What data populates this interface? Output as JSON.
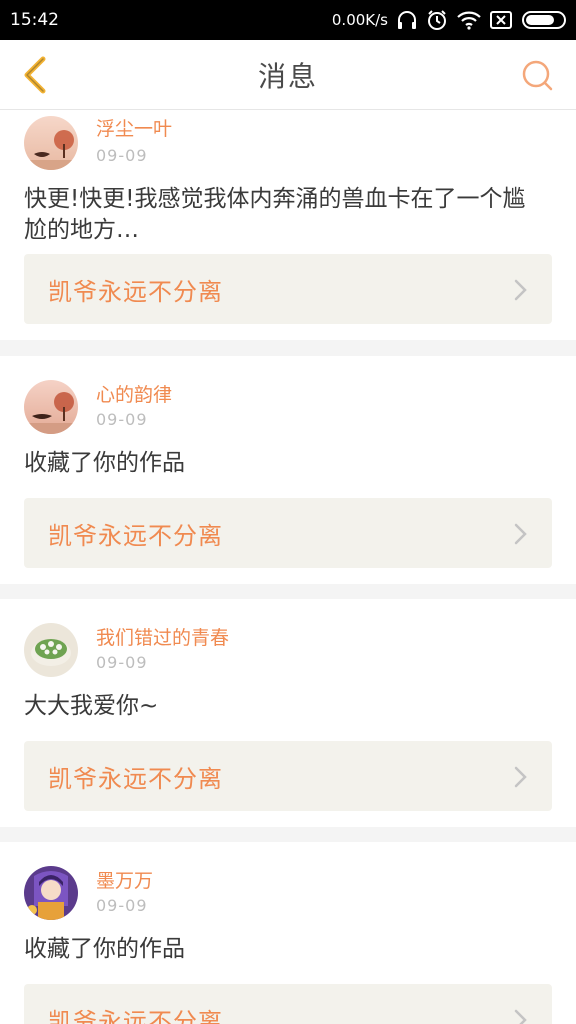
{
  "status_bar": {
    "time": "15:42",
    "network_speed": "0.00K/s",
    "icons": [
      "headphones-icon",
      "alarm-icon",
      "wifi-icon",
      "sim-icon",
      "battery-icon"
    ]
  },
  "header": {
    "title": "消息",
    "back_icon": "chevron-left-icon",
    "search_icon": "search-icon",
    "accent": "#f0a63c"
  },
  "messages": [
    {
      "username": "浮尘一叶",
      "date": "09-09",
      "text": "快更!快更!我感觉我体内奔涌的兽血卡在了一个尴尬的地方…",
      "work_title": "凯爷永远不分离",
      "avatar": "landscape-avatar"
    },
    {
      "username": "心的韵律",
      "date": "09-09",
      "text": "收藏了你的作品",
      "work_title": "凯爷永远不分离",
      "avatar": "landscape-avatar"
    },
    {
      "username": "我们错过的青春",
      "date": "09-09",
      "text": "大大我爱你~",
      "work_title": "凯爷永远不分离",
      "avatar": "cake-avatar"
    },
    {
      "username": "墨万万",
      "date": "09-09",
      "text": "收藏了你的作品",
      "work_title": "凯爷永远不分离",
      "avatar": "anime-avatar"
    }
  ],
  "colors": {
    "username": "#f08a50",
    "work_title": "#f08a50",
    "link_bg": "#f3f2ec"
  }
}
